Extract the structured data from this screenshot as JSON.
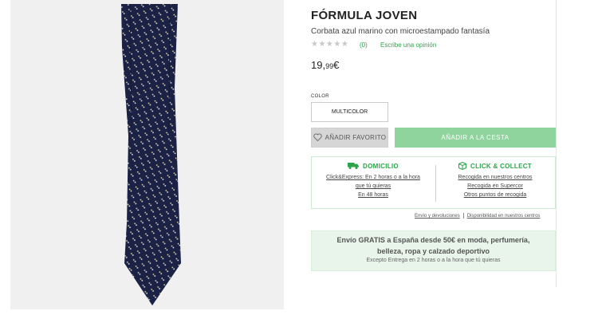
{
  "product": {
    "brand": "FÓRMULA JOVEN",
    "subtitle": "Corbata azul marino con microestampado fantasía",
    "stars": "★★★★★",
    "rating_count": "(0)",
    "review_link": "Escribe una opinión",
    "price_main": "19,",
    "price_cents": "99",
    "price_currency": "€"
  },
  "selector": {
    "color_label": "COLOR",
    "color_value": "MULTICOLOR"
  },
  "actions": {
    "favorite": "AÑADIR FAVORITO",
    "add_to_cart": "AÑADIR A LA CESTA"
  },
  "delivery": {
    "home": {
      "title": "DOMICILIO",
      "link1": "Click&Express: En 2 horas o a la hora",
      "link1b": "que tú quieras",
      "link2": "En 48 horas"
    },
    "collect": {
      "title": "CLICK & COLLECT",
      "link1": "Recogida en nuestros centros",
      "link2": "Recogida en Supercor",
      "link3": "Otros puntos de recogida"
    }
  },
  "info_links": {
    "shipping": "Envío y devoluciones",
    "availability": "Disponibilidad en nuestros centros"
  },
  "promo": {
    "line1": "Envío GRATIS a España desde 50€ en moda, perfumería,",
    "line2": "belleza, ropa y calzado deportivo",
    "line3": "Excepto Entrega en 2 horas o a la hora que tú quieras"
  },
  "colors": {
    "accent_green": "#2ea34a",
    "cart_green": "#8fd39d",
    "tie_navy": "#1b2246"
  },
  "icons": {
    "favorite": "heart-icon",
    "home": "truck-icon",
    "collect": "box-icon"
  }
}
